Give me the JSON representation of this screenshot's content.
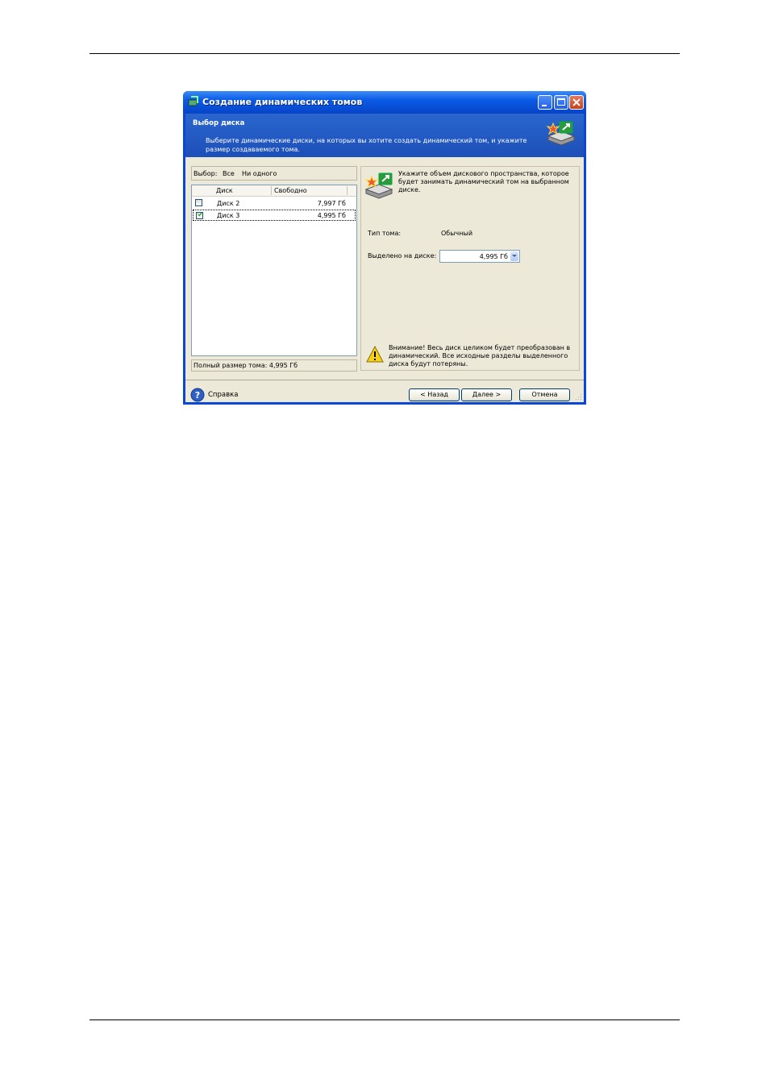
{
  "window": {
    "title": "Создание динамических томов"
  },
  "header": {
    "title": "Выбор диска",
    "description": "Выберите динамические диски, на которых вы хотите создать динамический том, и укажите размер создаваемого тома."
  },
  "selection": {
    "label": "Выбор:",
    "all": "Все",
    "none": "Ни одного"
  },
  "disk_list": {
    "columns": [
      "Диск",
      "Свободно"
    ],
    "rows": [
      {
        "name": "Диск 2",
        "free": "7,997 Гб",
        "checked": false
      },
      {
        "name": "Диск 3",
        "free": "4,995 Гб",
        "checked": true
      }
    ]
  },
  "total": {
    "label": "Полный размер тома: 4,995 Гб"
  },
  "details": {
    "instruction": "Укажите объем дискового пространства, которое будет занимать динамический том на выбранном диске.",
    "volume_type_label": "Тип тома:",
    "volume_type_value": "Обычный",
    "allocated_label": "Выделено на диске:",
    "allocated_value": "4,995 Гб",
    "warning": "Внимание! Весь диск целиком будет преобразован в динамический. Все исходные разделы выделенного диска будут потеряны."
  },
  "footer": {
    "help": "Справка",
    "back": "< Назад",
    "next": "Далее >",
    "cancel": "Отмена"
  },
  "colors": {
    "titlebar": "#0a5be6",
    "header": "#2a66cf",
    "dialog_bg": "#ece9d8",
    "close_button": "#c7401a"
  }
}
